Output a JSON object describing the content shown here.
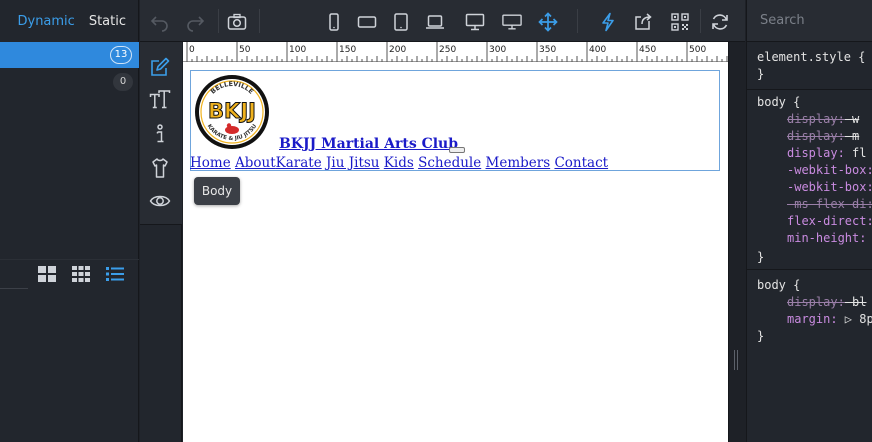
{
  "left_panel": {
    "tab_dynamic": "Dynamic",
    "tab_static": "Static",
    "badge_active": "13",
    "badge_second": "0"
  },
  "ruler": {
    "labels": [
      "0",
      "50",
      "100",
      "150",
      "200",
      "250",
      "300",
      "350",
      "400",
      "450",
      "500"
    ]
  },
  "canvas": {
    "title": "BKJJ Martial Arts Club",
    "logo": {
      "letters": "BKJJ",
      "arc_top": "BELLEVILLE",
      "arc_bottom": "KARATE & JIU JITSU"
    },
    "nav": [
      "Home",
      "About",
      "Karate",
      "Jiu Jitsu",
      "Kids",
      "Schedule",
      "Members",
      "Contact"
    ],
    "tooltip": "Body"
  },
  "css_panel": {
    "search_placeholder": "Search",
    "element_style": "element.style {",
    "close_brace": "}",
    "rule1_selector": "body {",
    "rule1_lines": [
      {
        "prop": "display",
        "value": "w",
        "struck": true
      },
      {
        "prop": "display",
        "value": "m",
        "struck": true
      },
      {
        "prop": "display",
        "value": "fl",
        "struck": false
      },
      {
        "prop": "-webkit-box",
        "value": "",
        "struck": false
      },
      {
        "prop": "-webkit-box",
        "value": "",
        "struck": false
      },
      {
        "prop": "-ms-flex-di",
        "value": "",
        "struck": true
      },
      {
        "prop": "flex-direct",
        "value": "",
        "struck": false
      },
      {
        "prop": "min-height",
        "value": "",
        "struck": false
      }
    ],
    "rule2_selector": "body {",
    "rule2_lines": [
      {
        "prop": "display",
        "value": "bl",
        "struck": true
      },
      {
        "prop": "margin",
        "value": "▷ 8p",
        "struck": false
      }
    ]
  },
  "colors": {
    "accent": "#2f89dd",
    "link": "#1a1ac8",
    "property": "#c98be0"
  }
}
